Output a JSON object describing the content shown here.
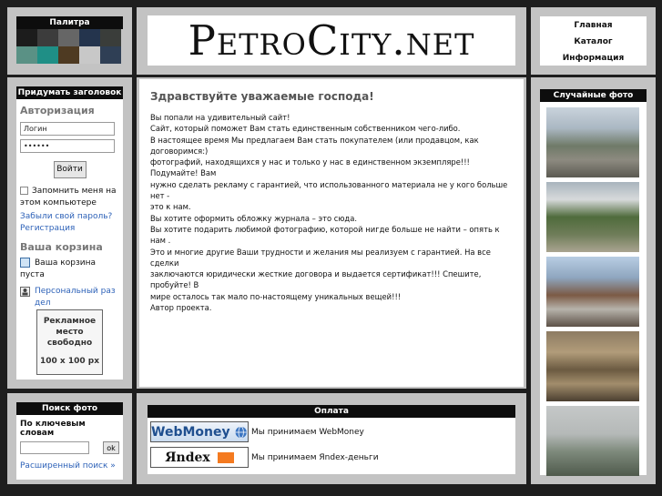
{
  "palette": {
    "title": "Палитра",
    "colors": [
      "#1c1c1c",
      "#3c3c3c",
      "#666666",
      "#24344d",
      "#3a3d3a",
      "#5a9185",
      "#1f8f86",
      "#4e3a22",
      "#c8c8c8",
      "#2f3f55"
    ]
  },
  "logo": {
    "text": "PetroCity.net"
  },
  "nav": {
    "items": [
      "Главная",
      "Каталог",
      "Информация"
    ]
  },
  "left": {
    "header": "Придумать заголовок",
    "auth_title": "Авторизация",
    "login_value": "Логин",
    "password_value": "••••••",
    "login_button": "Войти",
    "remember": "Запомнить меня на этом компьютере",
    "forgot": "Забыли свой пароль?",
    "register": "Регистрация",
    "cart_title": "Ваша корзина",
    "cart_empty": "Ваша корзина пуста",
    "personal": "Персональный раздел",
    "ad_line1": "Рекламное",
    "ad_line2": "место",
    "ad_line3": "свободно",
    "ad_size": "100 x 100 px"
  },
  "search": {
    "header": "Поиск фото",
    "keywords_label": "По ключевым словам",
    "button": "ok",
    "advanced": "Расширенный поиск »"
  },
  "main": {
    "title": "Здравствуйте уважаемые господа!",
    "lines": [
      "Вы попали на удивительный сайт!",
      "Сайт, который поможет Вам стать единственным собственником чего-либо.",
      "В настоящее время Мы предлагаем Вам стать покупателем (или продавцом, как договоримся:)",
      "фотографий, находящихся у нас и только у нас в единственном экземпляре!!! Подумайте! Вам",
      "нужно сделать рекламу с гарантией, что использованного материала не у кого больше нет -",
      "это к нам.",
      "Вы хотите оформить обложку журнала – это сюда.",
      "Вы хотите подарить любимой фотографию, которой нигде больше не найти – опять к нам .",
      "Это и многие другие Ваши трудности и желания мы реализуем с гарантией. На все сделки",
      "заключаются юридически жесткие договора и выдается сертификат!!! Спешите, пробуйте! В",
      "мире осталось так мало по-настоящему уникальных вещей!!!",
      "Автор проекта."
    ]
  },
  "payment": {
    "header": "Оплата",
    "webmoney_logo": "WebMoney",
    "webmoney_text": "Мы принимаем WebMoney",
    "yandex_logo": "Яndex",
    "yandex_text": "Мы принимаем Яndex-деньги"
  },
  "random": {
    "header": "Случайные фото"
  }
}
